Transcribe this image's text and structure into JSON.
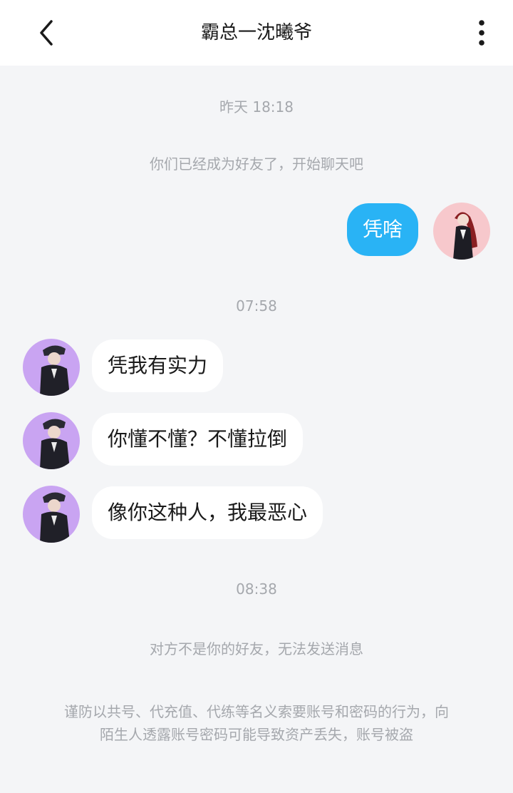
{
  "header": {
    "title": "霸总一沈曦爷",
    "back_icon": "chevron-left-icon",
    "more_icon": "more-vertical-icon"
  },
  "messages": {
    "time_yesterday": "昨天 18:18",
    "friend_notice": "你们已经成为好友了，开始聊天吧",
    "out_1": "凭啥",
    "time_0758": "07:58",
    "in_1": "凭我有实力",
    "in_2": "你懂不懂？不懂拉倒",
    "in_3": "像你这种人，我最恶心",
    "time_0838": "08:38",
    "not_friend_notice": "对方不是你的好友，无法发送消息"
  },
  "security_notice": {
    "line1": "谨防以共号、代充值、代练等名义索要账号和密码的行为，向",
    "line2": "陌生人透露账号密码可能导致资产丢失，账号被盗"
  },
  "colors": {
    "background": "#f4f5f7",
    "header_bg": "#ffffff",
    "outgoing_bubble": "#29b3f5",
    "incoming_bubble": "#ffffff",
    "system_text": "#a5a8ad",
    "other_avatar_bg": "#c9a4f2",
    "self_avatar_bg": "#f7c8cc"
  }
}
